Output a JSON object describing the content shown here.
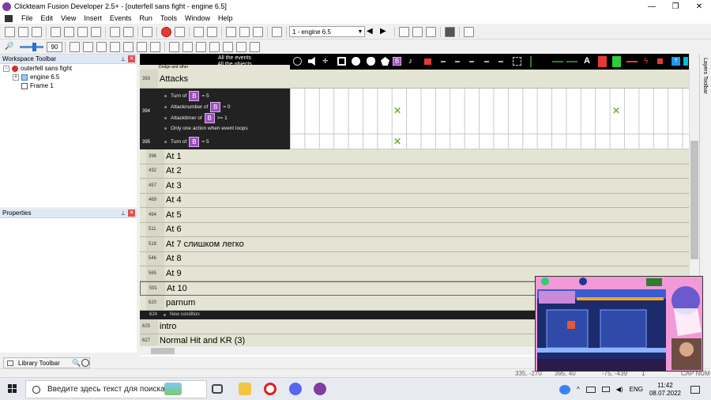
{
  "window": {
    "title": "Clickteam Fusion Developer 2.5+ - [outerfell sans fight - engine 6.5]",
    "controls": [
      "—",
      "❐",
      "✕"
    ]
  },
  "menu": [
    "File",
    "Edit",
    "View",
    "Insert",
    "Events",
    "Run",
    "Tools",
    "Window",
    "Help"
  ],
  "toolbar": {
    "frame_select": "1 - engine 6.5",
    "zoom_value": "90"
  },
  "workspace": {
    "title": "Workspace Toolbar",
    "tree": [
      {
        "label": "outerfell sans fight",
        "level": 0
      },
      {
        "label": "engine 6.5",
        "level": 1
      },
      {
        "label": "Frame 1",
        "level": 1
      }
    ]
  },
  "properties": {
    "title": "Properties"
  },
  "library": {
    "title": "Library Toolbar"
  },
  "layers": {
    "title": "Layers Toolbar"
  },
  "events": {
    "header_top": "All the events",
    "header_bottom": "All the objects",
    "partial_top": "Dodge and other",
    "groups": [
      {
        "num": "393",
        "name": "Attacks"
      },
      {
        "num": "396",
        "name": "At 1"
      },
      {
        "num": "432",
        "name": "At 2"
      },
      {
        "num": "457",
        "name": "At 3"
      },
      {
        "num": "469",
        "name": "At 4"
      },
      {
        "num": "494",
        "name": "At 5"
      },
      {
        "num": "511",
        "name": "At 6"
      },
      {
        "num": "518",
        "name": "At 7 слишком легко"
      },
      {
        "num": "546",
        "name": "At 8"
      },
      {
        "num": "565",
        "name": "At 9"
      },
      {
        "num": "591",
        "name": "At 10"
      },
      {
        "num": "620",
        "name": "parnum"
      }
    ],
    "event394": {
      "num": "394",
      "lines": [
        {
          "pre": "Turn of",
          "post": "= 5"
        },
        {
          "pre": "Attacknumber of",
          "post": "= 0"
        },
        {
          "pre": "Attacktimer of",
          "post": ">= 1"
        },
        {
          "pre": "Only one action when event loops",
          "post": ""
        }
      ]
    },
    "event395": {
      "num": "395",
      "lines": [
        {
          "pre": "Turn of",
          "post": "= 5"
        }
      ]
    },
    "new_condition": {
      "num": "624",
      "label": "New condition"
    },
    "bottom_groups": [
      {
        "num": "625",
        "name": "intro"
      },
      {
        "num": "627",
        "name": "Normal Hit and KR (3)"
      }
    ],
    "check_mark": "✕"
  },
  "status": {
    "coords1": "335, -270",
    "coords2": "395, 40",
    "coords3": "-75, -439",
    "count": "1",
    "caps": "CAP NUM"
  },
  "taskbar": {
    "search_placeholder": "Введите здесь текст для поиска",
    "lang": "ENG",
    "time": "11:42",
    "date": "08.07.2022"
  },
  "colors": {
    "accent_purple": "#9b4fc0",
    "group_bg": "#e4e4d4",
    "check_green": "#7cb342"
  }
}
